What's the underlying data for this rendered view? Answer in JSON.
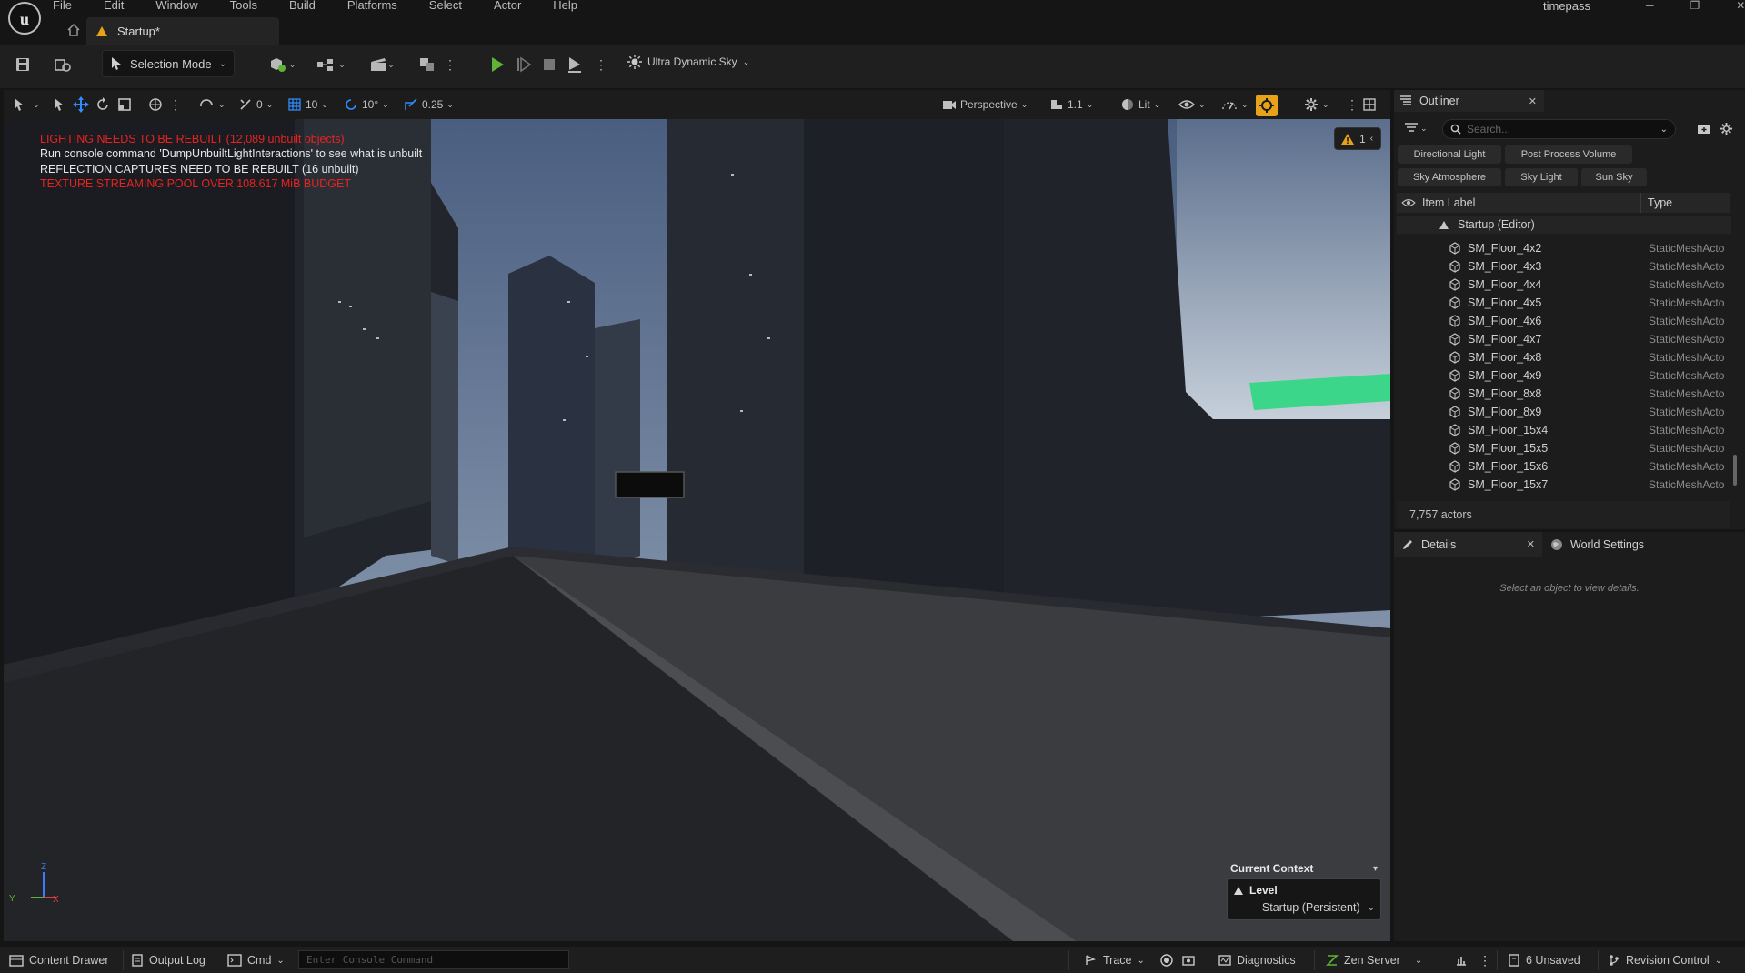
{
  "menu": {
    "items": [
      "File",
      "Edit",
      "Window",
      "Tools",
      "Build",
      "Platforms",
      "Select",
      "Actor",
      "Help"
    ],
    "project_name": "timepass"
  },
  "window_controls": {
    "minimize": "─",
    "restore": "❐",
    "close": "✕"
  },
  "tabs": {
    "level_tab": "Startup*"
  },
  "toolbar": {
    "selection_mode": "Selection Mode",
    "sky_label": "Ultra Dynamic Sky"
  },
  "viewport_toolbar": {
    "rotation_snap": "0",
    "grid_snap": "10",
    "angle_snap": "10°",
    "scale_snap": "0.25",
    "view_mode": "Perspective",
    "camera_speed": "1.1",
    "lighting_mode": "Lit"
  },
  "viewport": {
    "messages": [
      {
        "text": "LIGHTING NEEDS TO BE REBUILT (12,089 unbuilt objects)",
        "color": "#e8231f"
      },
      {
        "text": "Run console command 'DumpUnbuiltLightInteractions' to see what is unbuilt",
        "color": "#e6e6e6"
      },
      {
        "text": "REFLECTION CAPTURES NEED TO BE REBUILT (16 unbuilt)",
        "color": "#e6e6e6"
      },
      {
        "text": "TEXTURE STREAMING POOL OVER 108.617 MiB BUDGET",
        "color": "#e8231f"
      }
    ],
    "warning_count": "1",
    "axis": {
      "z": "Z",
      "y": "Y",
      "x": "X"
    },
    "current_context": {
      "title": "Current Context",
      "level_label": "Level",
      "level_value": "Startup (Persistent)"
    }
  },
  "outliner": {
    "title": "Outliner",
    "search_placeholder": "Search...",
    "filters": [
      "Directional Light",
      "Post Process Volume",
      "Sky Atmosphere",
      "Sky Light",
      "Sun Sky"
    ],
    "columns": {
      "label": "Item Label",
      "type": "Type"
    },
    "root": "Startup (Editor)",
    "rows": [
      {
        "name": "SM_Floor_4x2",
        "type": "StaticMeshActo"
      },
      {
        "name": "SM_Floor_4x3",
        "type": "StaticMeshActo"
      },
      {
        "name": "SM_Floor_4x4",
        "type": "StaticMeshActo"
      },
      {
        "name": "SM_Floor_4x5",
        "type": "StaticMeshActo"
      },
      {
        "name": "SM_Floor_4x6",
        "type": "StaticMeshActo"
      },
      {
        "name": "SM_Floor_4x7",
        "type": "StaticMeshActo"
      },
      {
        "name": "SM_Floor_4x8",
        "type": "StaticMeshActo"
      },
      {
        "name": "SM_Floor_4x9",
        "type": "StaticMeshActo"
      },
      {
        "name": "SM_Floor_8x8",
        "type": "StaticMeshActo"
      },
      {
        "name": "SM_Floor_8x9",
        "type": "StaticMeshActo"
      },
      {
        "name": "SM_Floor_15x4",
        "type": "StaticMeshActo"
      },
      {
        "name": "SM_Floor_15x5",
        "type": "StaticMeshActo"
      },
      {
        "name": "SM_Floor_15x6",
        "type": "StaticMeshActo"
      },
      {
        "name": "SM_Floor_15x7",
        "type": "StaticMeshActo"
      }
    ],
    "actor_count": "7,757 actors"
  },
  "details": {
    "tab": "Details",
    "world_settings_tab": "World Settings",
    "empty_message": "Select an object to view details."
  },
  "statusbar": {
    "content_drawer": "Content Drawer",
    "output_log": "Output Log",
    "cmd": "Cmd",
    "console_placeholder": "Enter Console Command",
    "trace": "Trace",
    "diagnostics": "Diagnostics",
    "zen_server": "Zen Server",
    "unsaved": "6 Unsaved",
    "revision_control": "Revision Control"
  },
  "colors": {
    "accent_play": "#5fb336",
    "snap_active": "#e8a21a",
    "error_text": "#e8231f"
  }
}
